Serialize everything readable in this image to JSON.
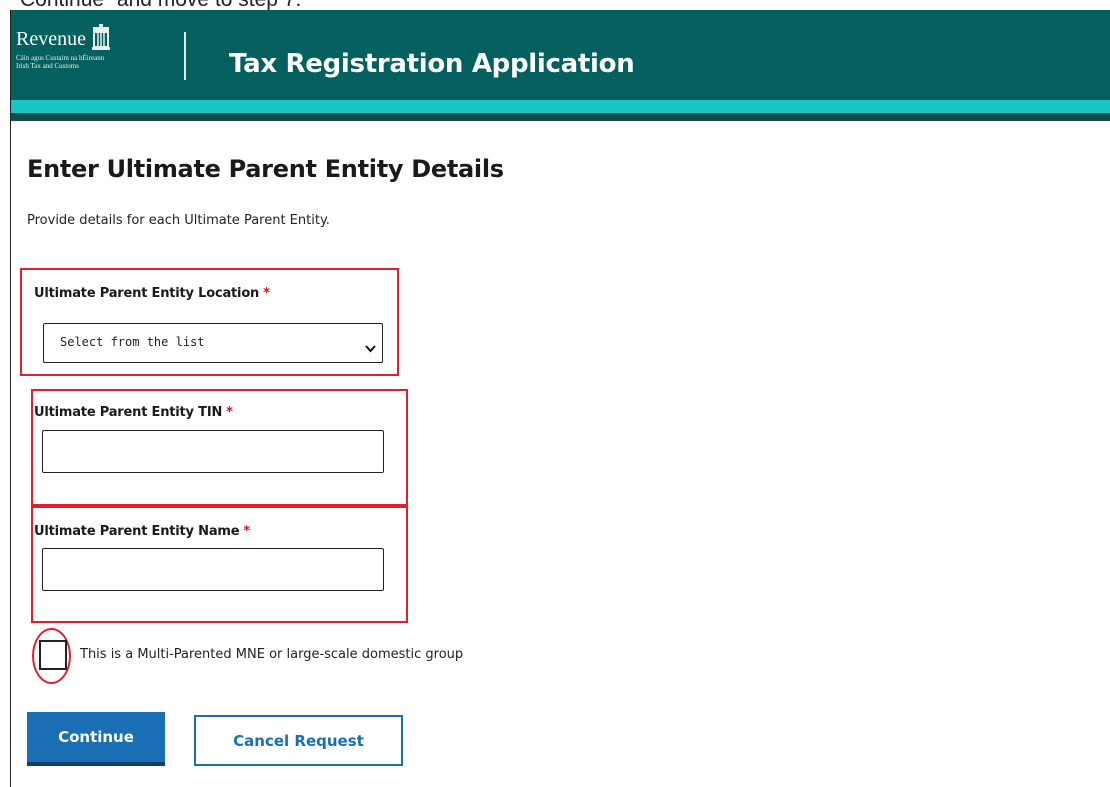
{
  "caption": "Continue” and move to step 7.",
  "header": {
    "logo_word": "Revenue",
    "logo_sub_line1": "Cáin agus Custaim na hÉireann",
    "logo_sub_line2": "Irish Tax and Customs",
    "app_title": "Tax Registration Application"
  },
  "page": {
    "title": "Enter Ultimate Parent Entity Details",
    "description": "Provide details for each Ultimate Parent Entity."
  },
  "form": {
    "required_marker": "*",
    "location": {
      "label": "Ultimate Parent Entity Location",
      "selected": "Select from the list"
    },
    "tin": {
      "label": "Ultimate Parent Entity TIN",
      "value": ""
    },
    "name": {
      "label": "Ultimate Parent Entity Name",
      "value": ""
    },
    "multi_parent": {
      "label": "This is a Multi-Parented MNE or large-scale domestic group",
      "checked": false
    }
  },
  "buttons": {
    "continue": "Continue",
    "cancel": "Cancel Request"
  },
  "colors": {
    "header_bg": "#03605f",
    "header_stripe": "#17c4c6",
    "primary": "#1a6eb3",
    "highlight": "#e0202f",
    "required": "#d4101c"
  }
}
